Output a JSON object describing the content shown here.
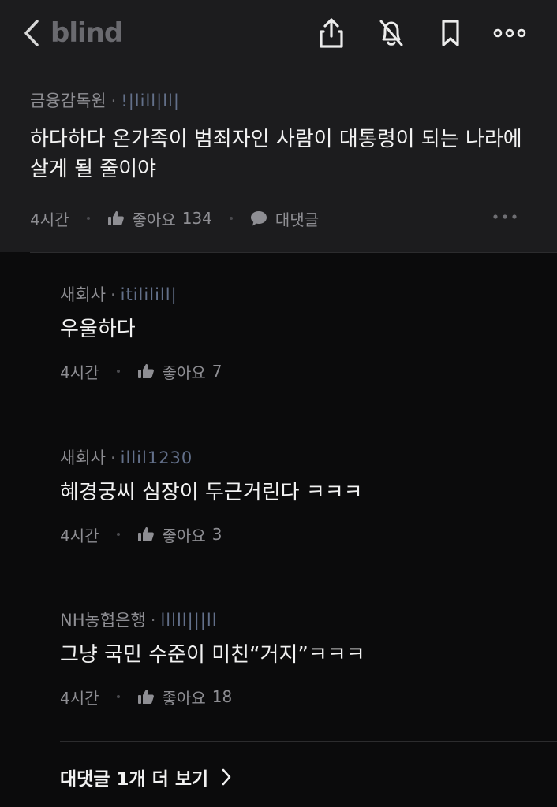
{
  "app": {
    "logo": "blind"
  },
  "post": {
    "company": "금융감독원",
    "separator": "·",
    "nickname": "!|lill|ll|",
    "body": "하다하다 온가족이 범죄자인 사람이 대통령이 되는 나라에 살게 될 줄이야",
    "time": "4시간",
    "like_label": "좋아요",
    "like_count": "134",
    "reply_label": "대댓글"
  },
  "replies": [
    {
      "company": "새회사",
      "separator": "·",
      "nickname": "itililill|",
      "text": "우울하다",
      "time": "4시간",
      "like_label": "좋아요",
      "like_count": "7"
    },
    {
      "company": "새회사",
      "separator": "·",
      "nickname": "illil1230",
      "text": "혜경궁씨 심장이 두근거린다 ㅋㅋㅋ",
      "time": "4시간",
      "like_label": "좋아요",
      "like_count": "3"
    },
    {
      "company": "NH농협은행",
      "separator": "·",
      "nickname": "lllll|||ll",
      "text": "그냥 국민 수준이 미친“거지”ㅋㅋㅋ",
      "time": "4시간",
      "like_label": "좋아요",
      "like_count": "18"
    }
  ],
  "more_replies": {
    "label": "대댓글 1개 더 보기"
  },
  "colors": {
    "header_bg": "#1c1c1e",
    "page_bg": "#0b0b0c",
    "nickname": "#63708a",
    "muted": "#8e8e93"
  },
  "icons": [
    "back-chevron-icon",
    "share-icon",
    "bell-off-icon",
    "bookmark-icon",
    "more-horizontal-icon",
    "thumbs-up-icon",
    "comment-bubble-icon",
    "chevron-right-icon"
  ]
}
